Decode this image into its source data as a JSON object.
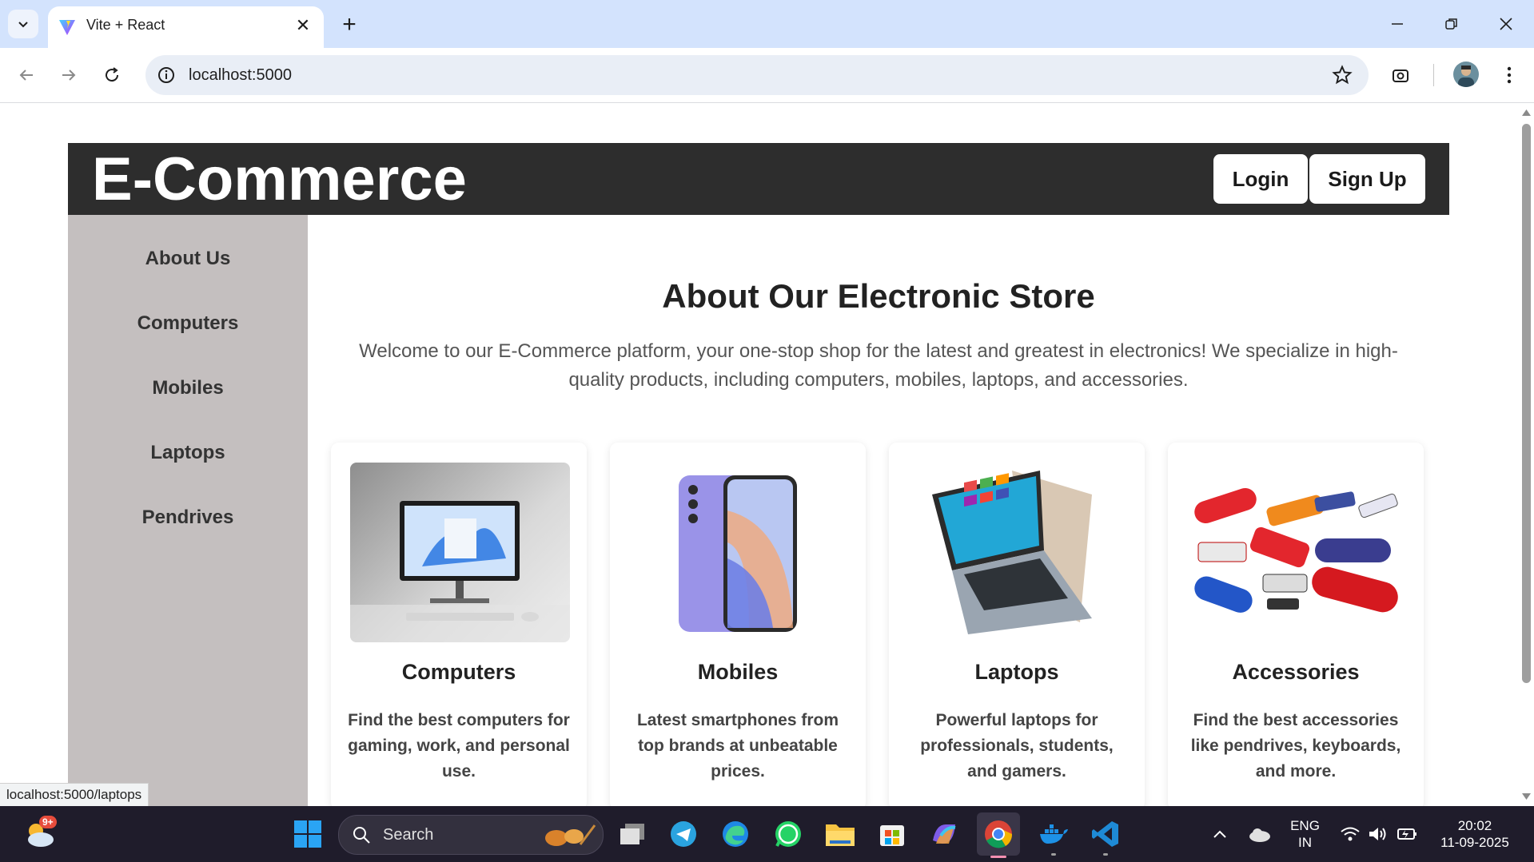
{
  "browser": {
    "tab_title": "Vite + React",
    "url": "localhost:5000",
    "status_url": "localhost:5000/laptops"
  },
  "header": {
    "logo": "E-Commerce",
    "login_label": "Login",
    "signup_label": "Sign Up"
  },
  "sidebar": {
    "items": [
      {
        "label": "About Us"
      },
      {
        "label": "Computers"
      },
      {
        "label": "Mobiles"
      },
      {
        "label": "Laptops"
      },
      {
        "label": "Pendrives"
      }
    ]
  },
  "main": {
    "title": "About Our Electronic Store",
    "description": "Welcome to our E-Commerce platform, your one-stop shop for the latest and greatest in electronics! We specialize in high-quality products, including computers, mobiles, laptops, and accessories.",
    "cards": [
      {
        "title": "Computers",
        "description": "Find the best computers for gaming, work, and personal use."
      },
      {
        "title": "Mobiles",
        "description": "Latest smartphones from top brands at unbeatable prices."
      },
      {
        "title": "Laptops",
        "description": "Powerful laptops for professionals, students, and gamers."
      },
      {
        "title": "Accessories",
        "description": "Find the best accessories like pendrives, keyboards, and more."
      }
    ]
  },
  "taskbar": {
    "search_placeholder": "Search",
    "weather_badge": "9+",
    "language": "ENG",
    "region": "IN",
    "time": "20:02",
    "date": "11-09-2025"
  },
  "colors": {
    "header_bg": "#2d2d2d",
    "sidebar_bg": "#c4bfbf",
    "tabstrip_bg": "#d3e3fd",
    "taskbar_bg": "#1f1c2b"
  }
}
